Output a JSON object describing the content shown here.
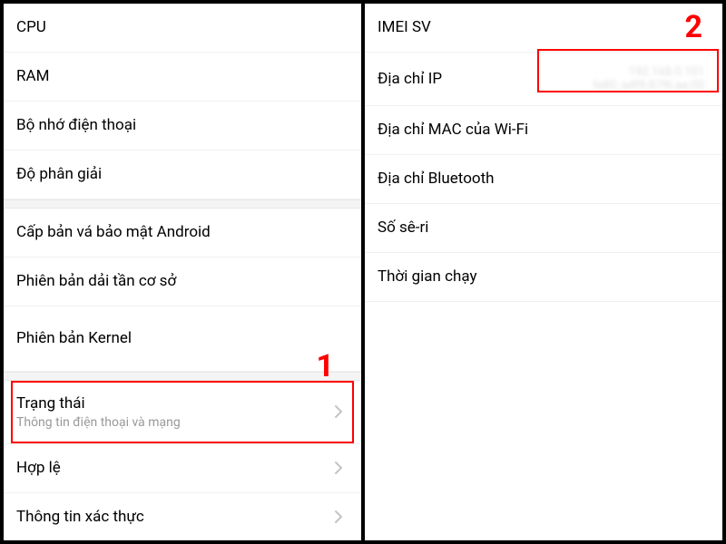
{
  "left": {
    "group1": [
      {
        "label": "CPU",
        "hasChevron": false
      },
      {
        "label": "RAM",
        "hasChevron": false
      },
      {
        "label": "Bộ nhớ điện thoại",
        "hasChevron": false
      },
      {
        "label": "Độ phân giải",
        "hasChevron": false
      }
    ],
    "group2": [
      {
        "label": "Cấp bản vá bảo mật Android",
        "hasChevron": false
      },
      {
        "label": "Phiên bản dải tần cơ sở",
        "hasChevron": false
      },
      {
        "label": "Phiên bản Kernel",
        "hasChevron": false,
        "tall": true
      }
    ],
    "group3": [
      {
        "label": "Trạng thái",
        "sub": "Thông tin điện thoại và mạng",
        "hasChevron": true,
        "highlighted": true
      },
      {
        "label": "Hợp lệ",
        "hasChevron": true
      },
      {
        "label": "Thông tin xác thực",
        "hasChevron": true
      }
    ]
  },
  "right": {
    "items": [
      {
        "label": "IMEI SV"
      },
      {
        "label": "Địa chỉ IP",
        "blurred": true
      },
      {
        "label": "Địa chỉ MAC của Wi-Fi"
      },
      {
        "label": "Địa chỉ Bluetooth"
      },
      {
        "label": "Số sê-ri"
      },
      {
        "label": "Thời gian chạy"
      }
    ]
  },
  "annotations": {
    "n1": "1",
    "n2": "2"
  }
}
